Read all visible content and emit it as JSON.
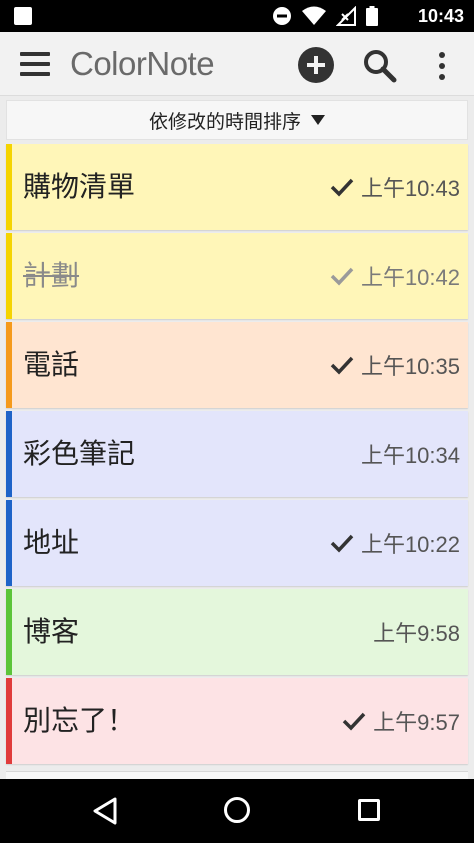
{
  "status_bar": {
    "time": "10:43",
    "icons": [
      "notification-icon",
      "do-not-disturb-icon",
      "wifi-icon",
      "no-signal-icon",
      "battery-icon"
    ]
  },
  "app_bar": {
    "title": "ColorNote",
    "icons": [
      "menu-icon",
      "add-note-icon",
      "search-icon",
      "more-vert-icon"
    ]
  },
  "sort": {
    "label": "依修改的時間排序"
  },
  "notes": [
    {
      "title": "購物清單",
      "time": "上午10:43",
      "checked": true,
      "struck": false,
      "color": "#fff6b8",
      "accent": "#f5d400"
    },
    {
      "title": "計劃",
      "time": "上午10:42",
      "checked": true,
      "struck": true,
      "color": "#fff6b8",
      "accent": "#f5d400"
    },
    {
      "title": "電話",
      "time": "上午10:35",
      "checked": true,
      "struck": false,
      "color": "#ffe5d1",
      "accent": "#f59a1b"
    },
    {
      "title": "彩色筆記",
      "time": "上午10:34",
      "checked": false,
      "struck": false,
      "color": "#e3e5fb",
      "accent": "#1e63c8"
    },
    {
      "title": "地址",
      "time": "上午10:22",
      "checked": true,
      "struck": false,
      "color": "#e3e5fb",
      "accent": "#1e63c8"
    },
    {
      "title": "博客",
      "time": "上午9:58",
      "checked": false,
      "struck": false,
      "color": "#e4f7dc",
      "accent": "#5cc43a"
    },
    {
      "title": "別忘了！",
      "time": "上午9:57",
      "checked": true,
      "struck": false,
      "color": "#fde3e5",
      "accent": "#e03b3b"
    }
  ],
  "nav_bar": {
    "icons": [
      "back-icon",
      "home-icon",
      "recents-icon"
    ]
  }
}
